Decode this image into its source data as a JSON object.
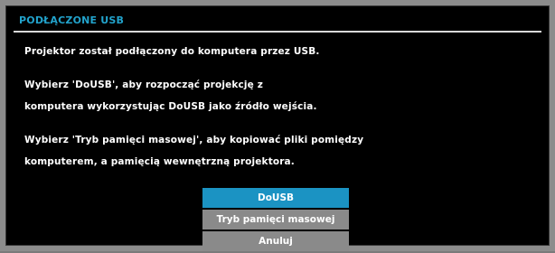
{
  "dialog": {
    "title": "PODŁĄCZONE USB",
    "lines": [
      "Projektor został podłączony do komputera przez USB.",
      "Wybierz 'DoUSB', aby rozpocząć projekcję z",
      "komputera wykorzystując DoUSB jako źródło wejścia.",
      "Wybierz 'Tryb pamięci masowej', aby kopiować pliki pomiędzy",
      "komputerem, a pamięcią wewnętrzną projektora."
    ]
  },
  "menu": {
    "options": [
      {
        "label": "DoUSB",
        "selected": true
      },
      {
        "label": "Tryb pamięci masowej",
        "selected": false
      },
      {
        "label": "Anuluj",
        "selected": false
      }
    ]
  },
  "colors": {
    "title": "#22a3cc",
    "selected_option": "#1b93c3",
    "option": "#8a8a8a",
    "dialog_background": "#000000"
  }
}
